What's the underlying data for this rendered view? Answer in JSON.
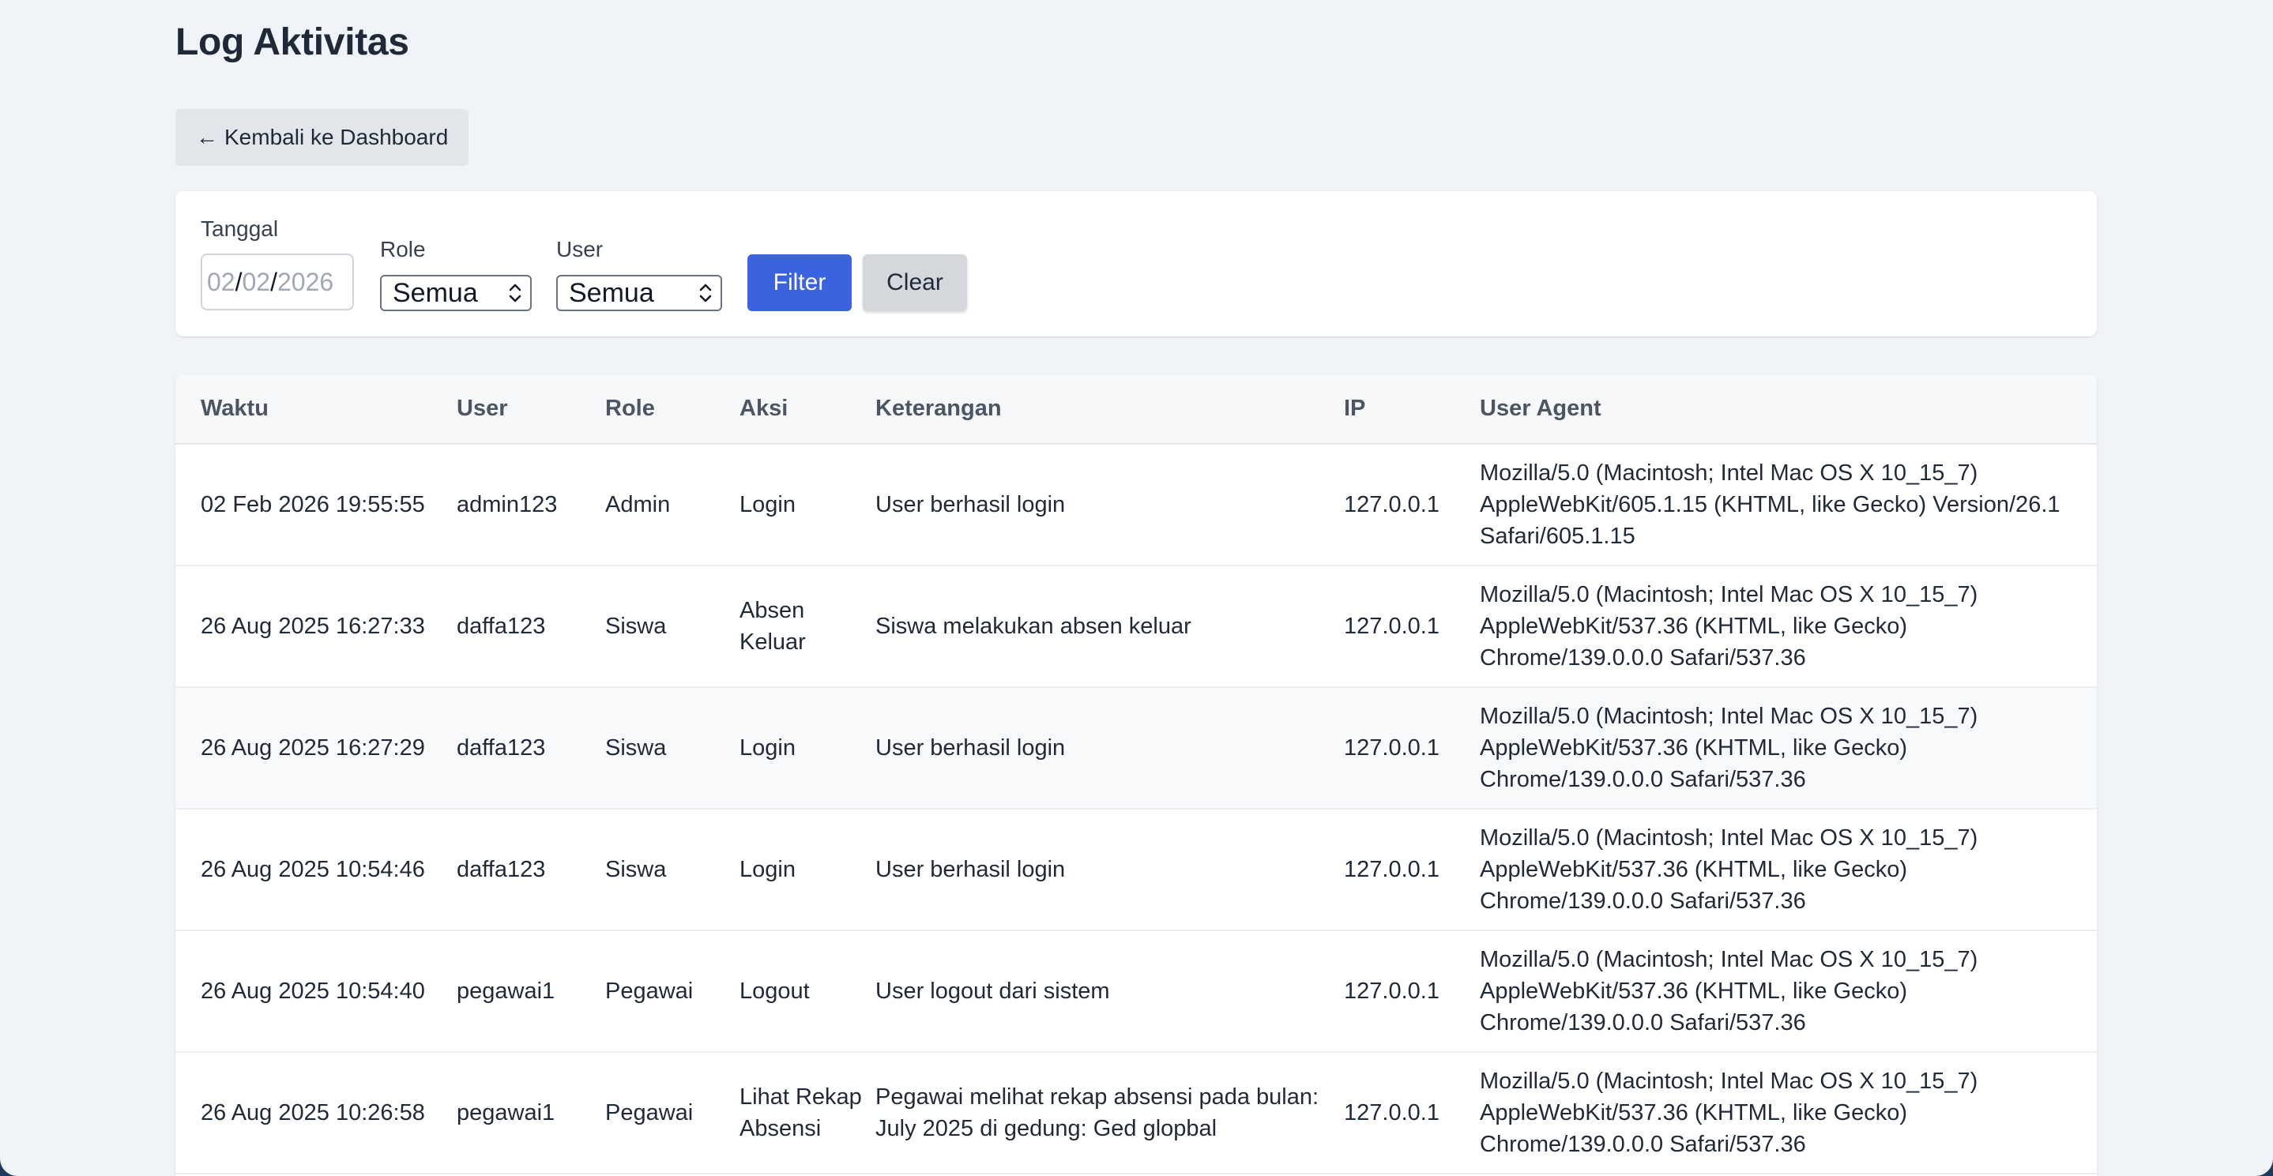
{
  "page": {
    "title": "Log Aktivitas",
    "back_label": "Kembali ke Dashboard"
  },
  "filter": {
    "date_label": "Tanggal",
    "date_value": {
      "day": "02",
      "month": "02",
      "year": "2026"
    },
    "role_label": "Role",
    "role_value": "Semua",
    "user_label": "User",
    "user_value": "Semua",
    "filter_button": "Filter",
    "clear_button": "Clear"
  },
  "table": {
    "headers": [
      "Waktu",
      "User",
      "Role",
      "Aksi",
      "Keterangan",
      "IP",
      "User Agent"
    ],
    "rows": [
      {
        "waktu": "02 Feb 2026 19:55:55",
        "user": "admin123",
        "role": "Admin",
        "aksi": "Login",
        "keterangan": "User berhasil login",
        "ip": "127.0.0.1",
        "user_agent": "Mozilla/5.0 (Macintosh; Intel Mac OS X 10_15_7) AppleWebKit/605.1.15 (KHTML, like Gecko) Version/26.1 Safari/605.1.15"
      },
      {
        "waktu": "26 Aug 2025 16:27:33",
        "user": "daffa123",
        "role": "Siswa",
        "aksi": "Absen Keluar",
        "keterangan": "Siswa melakukan absen keluar",
        "ip": "127.0.0.1",
        "user_agent": "Mozilla/5.0 (Macintosh; Intel Mac OS X 10_15_7) AppleWebKit/537.36 (KHTML, like Gecko) Chrome/139.0.0.0 Safari/537.36"
      },
      {
        "waktu": "26 Aug 2025 16:27:29",
        "user": "daffa123",
        "role": "Siswa",
        "aksi": "Login",
        "keterangan": "User berhasil login",
        "ip": "127.0.0.1",
        "user_agent": "Mozilla/5.0 (Macintosh; Intel Mac OS X 10_15_7) AppleWebKit/537.36 (KHTML, like Gecko) Chrome/139.0.0.0 Safari/537.36"
      },
      {
        "waktu": "26 Aug 2025 10:54:46",
        "user": "daffa123",
        "role": "Siswa",
        "aksi": "Login",
        "keterangan": "User berhasil login",
        "ip": "127.0.0.1",
        "user_agent": "Mozilla/5.0 (Macintosh; Intel Mac OS X 10_15_7) AppleWebKit/537.36 (KHTML, like Gecko) Chrome/139.0.0.0 Safari/537.36"
      },
      {
        "waktu": "26 Aug 2025 10:54:40",
        "user": "pegawai1",
        "role": "Pegawai",
        "aksi": "Logout",
        "keterangan": "User logout dari sistem",
        "ip": "127.0.0.1",
        "user_agent": "Mozilla/5.0 (Macintosh; Intel Mac OS X 10_15_7) AppleWebKit/537.36 (KHTML, like Gecko) Chrome/139.0.0.0 Safari/537.36"
      },
      {
        "waktu": "26 Aug 2025 10:26:58",
        "user": "pegawai1",
        "role": "Pegawai",
        "aksi": "Lihat Rekap Absensi",
        "keterangan": "Pegawai melihat rekap absensi pada bulan: July 2025 di gedung: Ged glopbal",
        "ip": "127.0.0.1",
        "user_agent": "Mozilla/5.0 (Macintosh; Intel Mac OS X 10_15_7) AppleWebKit/537.36 (KHTML, like Gecko) Chrome/139.0.0.0 Safari/537.36"
      }
    ]
  },
  "colors": {
    "accent": "#3b63e0",
    "background": "#f0f3f7"
  },
  "icons": {
    "back": "arrow-left-icon",
    "select_chevron": "chevron-updown-icon"
  }
}
